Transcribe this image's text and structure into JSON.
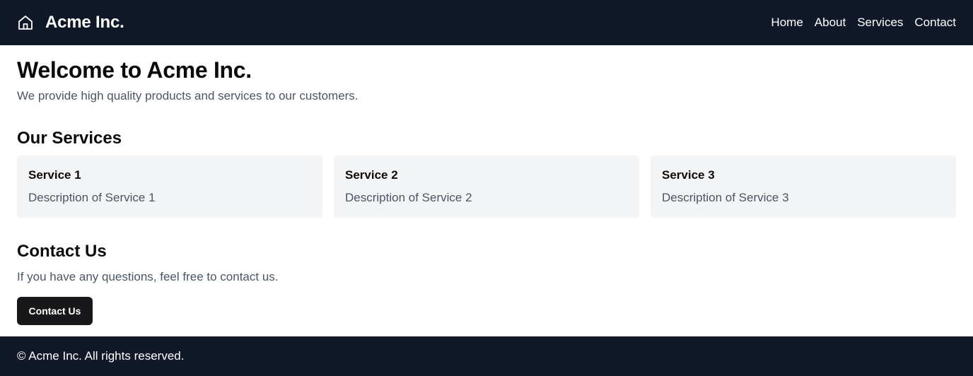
{
  "header": {
    "brand": "Acme Inc.",
    "brand_icon": "home-icon",
    "nav": [
      "Home",
      "About",
      "Services",
      "Contact"
    ]
  },
  "hero": {
    "title": "Welcome to Acme Inc.",
    "subtitle": "We provide high quality products and services to our customers."
  },
  "services": {
    "title": "Our Services",
    "items": [
      {
        "title": "Service 1",
        "description": "Description of Service 1"
      },
      {
        "title": "Service 2",
        "description": "Description of Service 2"
      },
      {
        "title": "Service 3",
        "description": "Description of Service 3"
      }
    ]
  },
  "contact": {
    "title": "Contact Us",
    "subtitle": "If you have any questions, feel free to contact us.",
    "button_label": "Contact Us"
  },
  "footer": {
    "text": "© Acme Inc. All rights reserved."
  },
  "colors": {
    "header_bg": "#111827",
    "card_bg": "#f3f4f6",
    "button_bg": "#18181b",
    "muted_text": "#4b5563"
  }
}
